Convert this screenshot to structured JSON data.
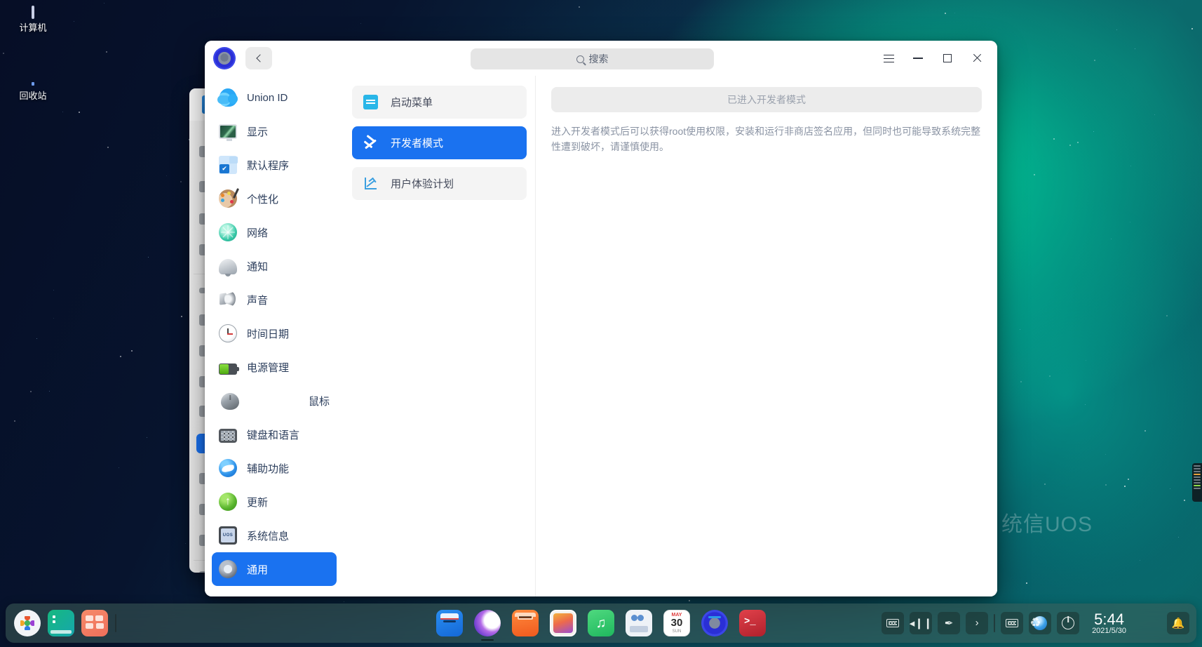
{
  "desktop": {
    "watermark": "统信UOS",
    "icons": [
      {
        "name": "computer",
        "label": "计算机"
      },
      {
        "name": "trash",
        "label": "回收站"
      }
    ]
  },
  "window": {
    "app_icon": "settings-gear-icon",
    "back_button": "back-arrow-icon",
    "search": {
      "placeholder": "搜索",
      "value": ""
    },
    "controls": {
      "menu": "hamburger-menu-icon",
      "minimize": "minimize-icon",
      "maximize": "maximize-icon",
      "close": "close-icon"
    }
  },
  "sidebar": {
    "items": [
      {
        "label": "Union ID",
        "icon": "cloud-icon",
        "icon_class": "ico-cloud",
        "active": false
      },
      {
        "label": "显示",
        "icon": "display-icon",
        "icon_class": "ico-display",
        "active": false
      },
      {
        "label": "默认程序",
        "icon": "default-apps-icon",
        "icon_class": "ico-default",
        "active": false
      },
      {
        "label": "个性化",
        "icon": "palette-icon",
        "icon_class": "ico-person",
        "active": false
      },
      {
        "label": "网络",
        "icon": "globe-icon",
        "icon_class": "ico-network",
        "active": false
      },
      {
        "label": "通知",
        "icon": "bell-icon",
        "icon_class": "ico-bell",
        "active": false
      },
      {
        "label": "声音",
        "icon": "speaker-icon",
        "icon_class": "ico-sound",
        "active": false
      },
      {
        "label": "时间日期",
        "icon": "clock-icon",
        "icon_class": "ico-clock",
        "active": false
      },
      {
        "label": "电源管理",
        "icon": "battery-icon",
        "icon_class": "ico-battery",
        "active": false
      },
      {
        "label": "鼠标",
        "icon": "mouse-icon",
        "icon_class": "ico-mouse",
        "active": false
      },
      {
        "label": "键盘和语言",
        "icon": "keyboard-icon",
        "icon_class": "ico-keyboard",
        "active": false
      },
      {
        "label": "辅助功能",
        "icon": "accessibility-icon",
        "icon_class": "ico-access",
        "active": false
      },
      {
        "label": "更新",
        "icon": "update-arrow-icon",
        "icon_class": "ico-update",
        "active": false
      },
      {
        "label": "系统信息",
        "icon": "system-info-icon",
        "icon_class": "ico-sysinfo",
        "active": false
      },
      {
        "label": "通用",
        "icon": "general-gear-icon",
        "icon_class": "ico-general",
        "active": true
      }
    ]
  },
  "midlist": {
    "items": [
      {
        "label": "启动菜单",
        "icon": "start-menu-icon",
        "icon_class": "mi-menu",
        "active": false
      },
      {
        "label": "开发者模式",
        "icon": "developer-tools-icon",
        "icon_class": "mi-dev",
        "active": true
      },
      {
        "label": "用户体验计划",
        "icon": "trend-chart-icon",
        "icon_class": "mi-chart",
        "active": false
      }
    ]
  },
  "detail": {
    "status_button": "已进入开发者模式",
    "status_button_enabled": false,
    "description": "进入开发者模式后可以获得root使用权限，安装和运行非商店签名应用，但同时也可能导致系统完整性遭到破坏，请谨慎使用。"
  },
  "dock": {
    "left": [
      {
        "name": "launcher",
        "icon": "launcher-icon",
        "class": "d-launcher",
        "running": false
      },
      {
        "name": "terminal",
        "icon": "terminal-icon",
        "class": "d-terminal",
        "running": false
      },
      {
        "name": "app-store",
        "icon": "apps-grid-icon",
        "class": "d-apps",
        "running": false
      }
    ],
    "center": [
      {
        "name": "file-manager",
        "icon": "file-manager-icon",
        "class": "d-store",
        "running": true
      },
      {
        "name": "browser",
        "icon": "browser-icon",
        "class": "d-browser",
        "running": true
      },
      {
        "name": "app-market",
        "icon": "shopping-bag-icon",
        "class": "d-market",
        "running": true
      },
      {
        "name": "photo-viewer",
        "icon": "photos-icon",
        "class": "d-photos",
        "running": false
      },
      {
        "name": "music-player",
        "icon": "music-note-icon",
        "class": "d-music",
        "running": false
      },
      {
        "name": "contacts",
        "icon": "contacts-icon",
        "class": "d-contacts",
        "running": false
      },
      {
        "name": "calendar",
        "icon": "calendar-icon",
        "class": "d-calendar",
        "running": false,
        "month": "MAY",
        "day": "30",
        "weekday": "SUN"
      },
      {
        "name": "control-center",
        "icon": "settings-gear-icon",
        "class": "d-settings",
        "running": true
      },
      {
        "name": "terminal-red",
        "icon": "terminal-prompt-icon",
        "class": "d-term2",
        "running": false
      }
    ],
    "tray": [
      {
        "name": "onboard-keyboard",
        "icon": "keyboard-icon"
      },
      {
        "name": "volume",
        "icon": "speaker-volume-icon",
        "glyph": "◂❙❙"
      },
      {
        "name": "brightness",
        "icon": "brightness-pen-icon",
        "glyph": "✒"
      },
      {
        "name": "tray-expand",
        "icon": "chevron-right-icon",
        "glyph": "›"
      }
    ],
    "tray2": [
      {
        "name": "input-method",
        "icon": "keyboard-small-icon"
      },
      {
        "name": "network",
        "icon": "network-globe-icon",
        "glyph": "ἱ0"
      },
      {
        "name": "power",
        "icon": "power-icon",
        "glyph": "⏻"
      }
    ],
    "clock": {
      "time": "5:44",
      "date": "2021/5/30"
    },
    "end": [
      {
        "name": "trash",
        "icon": "trash-icon"
      },
      {
        "name": "notifications",
        "icon": "bell-icon",
        "glyph": "🔔"
      }
    ]
  }
}
